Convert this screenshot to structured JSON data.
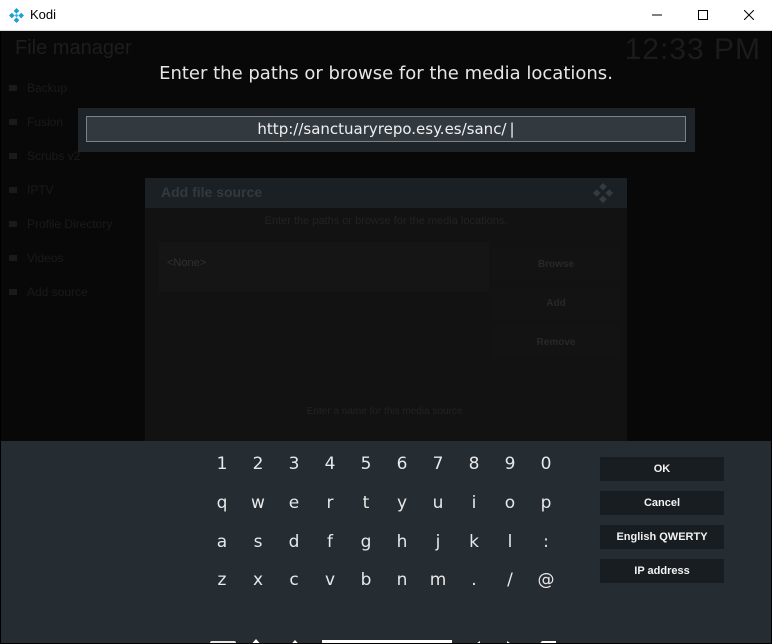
{
  "window": {
    "title": "Kodi",
    "icon": "kodi-logo-icon",
    "controls": [
      "minimize-icon",
      "maximize-icon",
      "close-icon"
    ]
  },
  "background": {
    "page_title": "File manager",
    "clock": "12:33 PM",
    "sources": [
      "Backup",
      "Fusion",
      "Scrubs v2",
      "IPTV",
      "Profile Directory",
      "Videos",
      "Add source"
    ]
  },
  "dialog": {
    "title": "Add file source",
    "subtitle": "Enter the paths or browse for the media locations.",
    "path_value": "<None>",
    "buttons": [
      "Browse",
      "Add",
      "Remove"
    ],
    "name_prompt": "Enter a name for this media source."
  },
  "keyboard_dialog": {
    "heading": "Enter the paths or browse for the media locations.",
    "input_value": "http://sanctuaryrepo.esy.es/sanc/",
    "rows": [
      [
        "1",
        "2",
        "3",
        "4",
        "5",
        "6",
        "7",
        "8",
        "9",
        "0"
      ],
      [
        "q",
        "w",
        "e",
        "r",
        "t",
        "y",
        "u",
        "i",
        "o",
        "p"
      ],
      [
        "a",
        "s",
        "d",
        "f",
        "g",
        "h",
        "j",
        "k",
        "l",
        ":"
      ],
      [
        "z",
        "x",
        "c",
        "v",
        "b",
        "n",
        "m",
        ".",
        "/",
        "@"
      ]
    ],
    "side_buttons": [
      "OK",
      "Cancel",
      "English QWERTY",
      "IP address"
    ],
    "symbols_key": "#+=",
    "bottom_icons": [
      "symbols-key",
      "caps-lock-icon",
      "shift-icon",
      "space-bar",
      "arrow-left-icon",
      "arrow-right-icon",
      "backspace-icon"
    ]
  },
  "colors": {
    "accent": "#12b2e7",
    "keyboard_bg": "#252c32",
    "input_bg": "#323a40"
  }
}
